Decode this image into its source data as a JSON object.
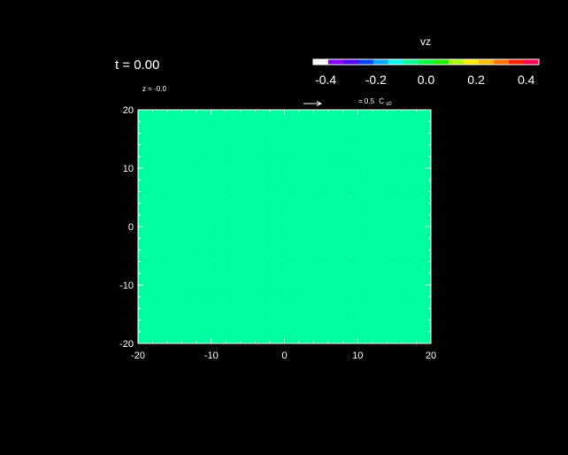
{
  "chart_data": {
    "type": "heatmap",
    "time_label": "t = 0.00",
    "slice_label": "z = -0.0",
    "colorbar": {
      "label": "vz",
      "range": [
        -0.45,
        0.45
      ],
      "ticks": [
        "-0.4",
        "-0.2",
        "0.0",
        "0.2",
        "0.4"
      ],
      "tick_values": [
        -0.4,
        -0.2,
        0.0,
        0.2,
        0.4
      ],
      "colors": [
        "#ffffff",
        "#8800ff",
        "#5500ff",
        "#0044ff",
        "#00aaff",
        "#00ffee",
        "#00ff99",
        "#00ff44",
        "#22ee00",
        "#aaff00",
        "#ffee00",
        "#ffbb00",
        "#ff7700",
        "#ff2200",
        "#ff0055"
      ]
    },
    "vector_legend": {
      "value_text": "= 0.5",
      "unit_main": "C",
      "unit_sub": "s0"
    },
    "field": {
      "value": 0.0,
      "fill_color": "#00ffa0"
    },
    "x_axis": {
      "range": [
        -20,
        20
      ],
      "ticks": [
        "-20",
        "-10",
        "0",
        "10",
        "20"
      ],
      "tick_values": [
        -20,
        -10,
        0,
        10,
        20
      ]
    },
    "y_axis": {
      "range": [
        -20,
        20
      ],
      "ticks": [
        "-20",
        "-10",
        "0",
        "10",
        "20"
      ],
      "tick_values": [
        -20,
        -10,
        0,
        10,
        20
      ]
    }
  }
}
